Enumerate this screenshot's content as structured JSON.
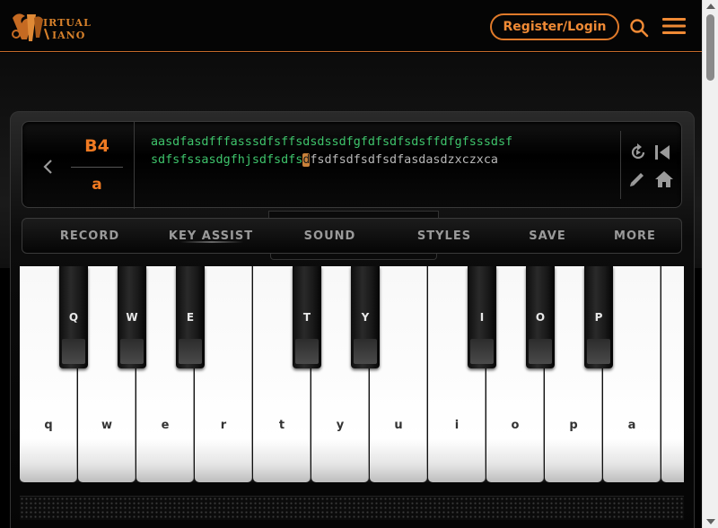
{
  "header": {
    "logo_line1": "IRTUAL",
    "logo_line2": "IANO",
    "register_label": "Register/Login",
    "icons": [
      "logo-icon",
      "search-icon",
      "menu-icon"
    ],
    "accent_color": "#f08a35"
  },
  "display": {
    "note_name": "B4",
    "note_key": "a",
    "sheet_line1": "aasdfasdfffasssdfsffsdsdssdfgfdfsdfsdsffdfgfsssdsf",
    "sheet_line2_played": "sdfsfssasdgfhjsdfsdfs",
    "sheet_line2_current": "d",
    "sheet_line2_upcoming": "fsdfsdfsdfsdfasdasdzxczxca",
    "played_color": "#3ec36b",
    "icons": [
      "chevron-left-icon",
      "replay-icon",
      "skip-start-icon",
      "pencil-icon",
      "home-icon"
    ]
  },
  "toolbar": {
    "tabs": [
      {
        "label": "RECORD"
      },
      {
        "label": "KEY ASSIST"
      },
      {
        "label": "SOUND"
      },
      {
        "label": "STYLES"
      },
      {
        "label": "SAVE"
      },
      {
        "label": "MORE"
      }
    ]
  },
  "keyboard": {
    "white_keys": [
      "q",
      "w",
      "e",
      "r",
      "t",
      "y",
      "u",
      "i",
      "o",
      "p",
      "a",
      ""
    ],
    "black_keys": [
      "Q",
      "W",
      "E",
      "T",
      "Y",
      "I",
      "O",
      "P"
    ]
  }
}
